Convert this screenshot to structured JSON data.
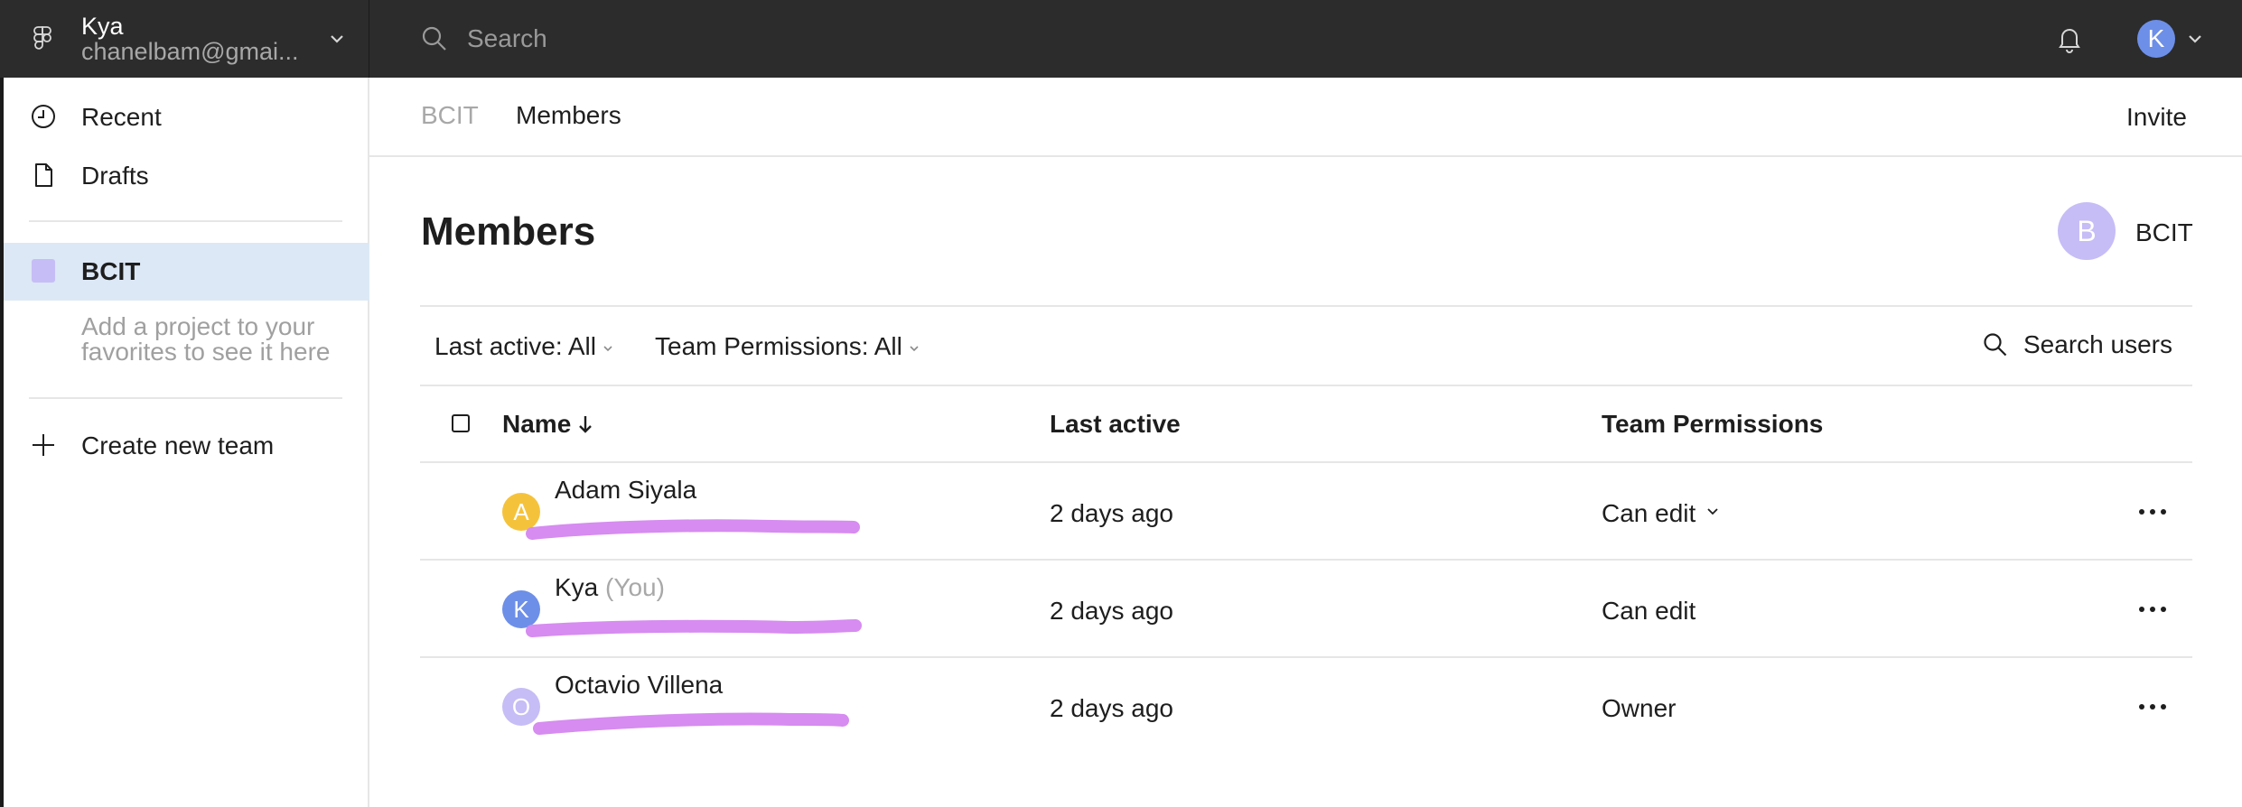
{
  "account": {
    "name": "Kya",
    "email": "chanelbam@gmai..."
  },
  "search": {
    "placeholder": "Search"
  },
  "user_avatar": {
    "initial": "K",
    "color": "#6d8fe8"
  },
  "sidebar": {
    "items": [
      {
        "label": "Recent",
        "icon": "clock-icon"
      },
      {
        "label": "Drafts",
        "icon": "file-icon"
      }
    ],
    "team": {
      "label": "BCIT",
      "color": "#c6bdf6"
    },
    "favorites_hint": "Add a project to your favorites to see it here",
    "create_team_label": "Create new team"
  },
  "breadcrumb": {
    "team": "BCIT",
    "page": "Members"
  },
  "invite_label": "Invite",
  "page_title": "Members",
  "team_badge": {
    "initial": "B",
    "name": "BCIT"
  },
  "filters": {
    "last_active": "Last active: All",
    "permissions": "Team Permissions: All",
    "search_users": "Search users"
  },
  "table": {
    "columns": {
      "name": "Name",
      "last_active": "Last active",
      "permissions": "Team Permissions"
    },
    "rows": [
      {
        "initial": "A",
        "avatar_color": "#f5c33b",
        "name": "Adam Siyala",
        "you": "",
        "last_active": "2 days ago",
        "permission": "Can edit",
        "permission_dropdown": true
      },
      {
        "initial": "K",
        "avatar_color": "#6d8fe8",
        "name": "Kya",
        "you": "(You)",
        "last_active": "2 days ago",
        "permission": "Can edit",
        "permission_dropdown": false
      },
      {
        "initial": "O",
        "avatar_color": "#c6bdf6",
        "name": "Octavio Villena",
        "you": "",
        "last_active": "2 days ago",
        "permission": "Owner",
        "permission_dropdown": false
      }
    ]
  },
  "redaction_color": "#d68cf0"
}
